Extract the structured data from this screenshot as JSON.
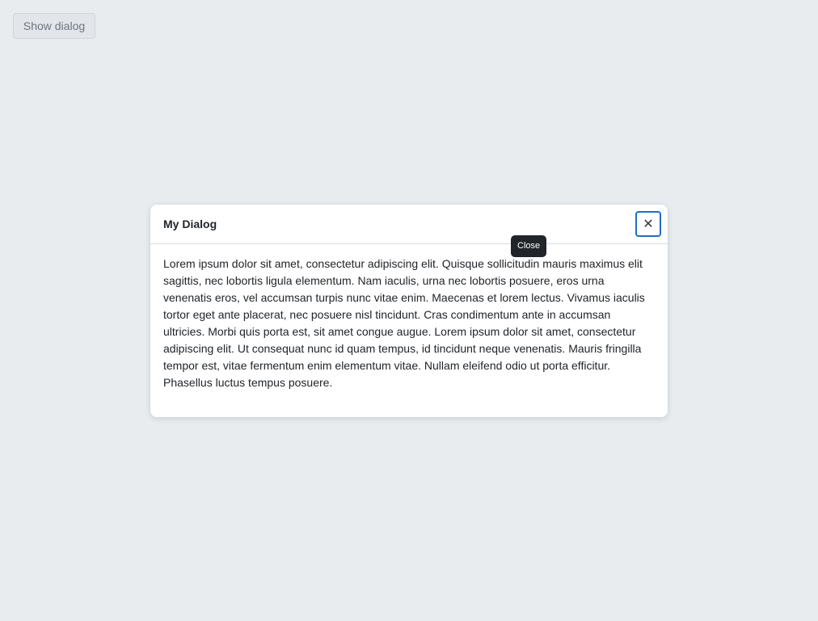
{
  "page": {
    "show_dialog_label": "Show dialog"
  },
  "dialog": {
    "title": "My Dialog",
    "close_glyph": "✕",
    "close_tooltip": "Close",
    "body": "Lorem ipsum dolor sit amet, consectetur adipiscing elit. Quisque sollicitudin mauris maximus elit sagittis, nec lobortis ligula elementum. Nam iaculis, urna nec lobortis posuere, eros urna venenatis eros, vel accumsan turpis nunc vitae enim. Maecenas et lorem lectus. Vivamus iaculis tortor eget ante placerat, nec posuere nisl tincidunt. Cras condimentum ante in accumsan ultricies. Morbi quis porta est, sit amet congue augue. Lorem ipsum dolor sit amet, consectetur adipiscing elit. Ut consequat nunc id quam tempus, id tincidunt neque venenatis. Mauris fringilla tempor est, vitae fermentum enim elementum vitae. Nullam eleifend odio ut porta efficitur. Phasellus luctus tempus posuere."
  },
  "icons": {
    "close": "close-icon"
  },
  "colors": {
    "page_background": "#e8ecef",
    "dialog_background": "#ffffff",
    "focus_ring": "#1f6fbf",
    "tooltip_background": "#212529"
  }
}
